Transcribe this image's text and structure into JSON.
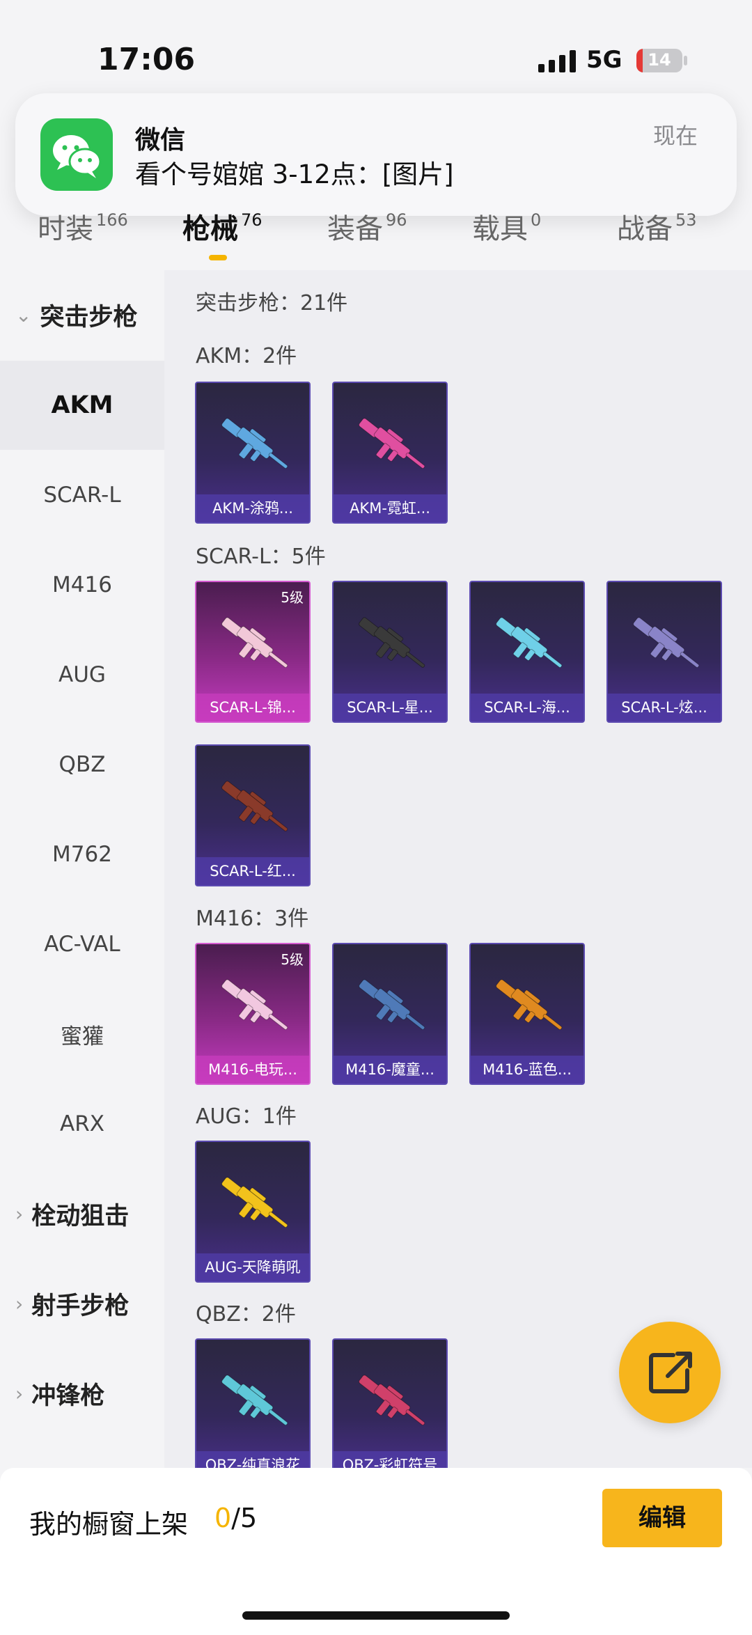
{
  "status": {
    "time": "17:06",
    "network": "5G",
    "battery": "14",
    "battery_level": 0.14
  },
  "notification": {
    "app": "微信",
    "message": "看个号婠婠 3-12点：[图片]",
    "time": "现在"
  },
  "tabs": [
    {
      "label": "时装",
      "count": "166"
    },
    {
      "label": "枪械",
      "count": "76"
    },
    {
      "label": "装备",
      "count": "96"
    },
    {
      "label": "载具",
      "count": "0"
    },
    {
      "label": "战备",
      "count": "53"
    }
  ],
  "sidebar": {
    "groups": [
      {
        "label": "突击步枪",
        "arrow": "⌄"
      },
      {
        "label": "栓动狙击",
        "arrow": "›"
      },
      {
        "label": "射手步枪",
        "arrow": "›"
      },
      {
        "label": "冲锋枪",
        "arrow": "›"
      }
    ],
    "items": [
      "AKM",
      "SCAR-L",
      "M416",
      "AUG",
      "QBZ",
      "M762",
      "AC-VAL",
      "蜜獾",
      "ARX"
    ]
  },
  "content": {
    "header": "突击步枪：21件",
    "sections": [
      {
        "title": "AKM：2件",
        "cards": [
          {
            "label": "AKM-涂鸦...",
            "level": "",
            "color": "#5fa8e0"
          },
          {
            "label": "AKM-霓虹...",
            "level": "",
            "color": "#e04fa0"
          }
        ]
      },
      {
        "title": "SCAR-L：5件",
        "cards": [
          {
            "label": "SCAR-L-锦...",
            "level": "5级",
            "color": "#f2c8d8"
          },
          {
            "label": "SCAR-L-星...",
            "level": "",
            "color": "#3a3a3a"
          },
          {
            "label": "SCAR-L-海...",
            "level": "",
            "color": "#6fd0e8"
          },
          {
            "label": "SCAR-L-炫...",
            "level": "",
            "color": "#8a84c8"
          },
          {
            "label": "SCAR-L-红...",
            "level": "",
            "color": "#8a3a2a"
          }
        ]
      },
      {
        "title": "M416：3件",
        "cards": [
          {
            "label": "M416-电玩...",
            "level": "5级",
            "color": "#f2c8e0"
          },
          {
            "label": "M416-魔童...",
            "level": "",
            "color": "#4f7ab8"
          },
          {
            "label": "M416-蓝色...",
            "level": "",
            "color": "#e08a20"
          }
        ]
      },
      {
        "title": "AUG：1件",
        "cards": [
          {
            "label": "AUG-天降萌吼",
            "level": "",
            "color": "#f2c21c"
          }
        ]
      },
      {
        "title": "QBZ：2件",
        "cards": [
          {
            "label": "QBZ-纯真浪花",
            "level": "",
            "color": "#5fc8d8"
          },
          {
            "label": "QBZ-彩虹符号",
            "level": "",
            "color": "#d0406a"
          }
        ]
      }
    ]
  },
  "bottom": {
    "label": "我的橱窗上架",
    "current": "0",
    "total": "/5",
    "edit": "编辑"
  },
  "colors": {
    "accent": "#f5b400",
    "card_base": "#33285a",
    "card_lv5": "#c43bc0"
  }
}
